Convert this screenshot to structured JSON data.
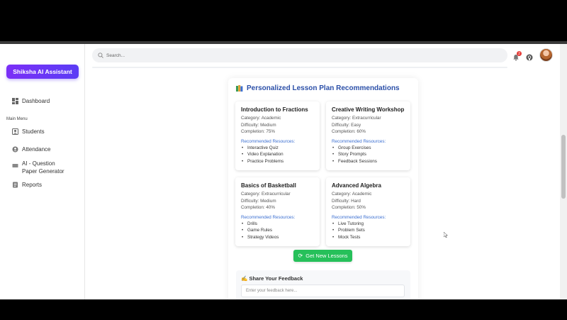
{
  "sidebar": {
    "brand": "Shiksha AI Assistant",
    "dashboard": "Dashboard",
    "menu_heading": "Main Menu",
    "items": [
      {
        "label": "Students",
        "icon": "student-icon"
      },
      {
        "label": "Attendance",
        "icon": "attendance-icon"
      },
      {
        "label": "AI - Question Paper Generator",
        "icon": "document-icon"
      },
      {
        "label": "Reports",
        "icon": "report-icon"
      }
    ]
  },
  "header": {
    "search_placeholder": "Search...",
    "notification_count": "2",
    "icons": [
      "search-icon",
      "bell-icon",
      "github-icon",
      "avatar"
    ]
  },
  "main": {
    "title": "Personalized Lesson Plan Recommendations",
    "cards": [
      {
        "title": "Introduction to Fractions",
        "category": "Category: Academic",
        "difficulty": "Difficulty: Medium",
        "completion": "Completion: 75%",
        "resources_label": "Recommended Resources:",
        "resources": [
          "Interactive Quiz",
          "Video Explanation",
          "Practice Problems"
        ]
      },
      {
        "title": "Creative Writing Workshop",
        "category": "Category: Extracurricular",
        "difficulty": "Difficulty: Easy",
        "completion": "Completion: 60%",
        "resources_label": "Recommended Resources:",
        "resources": [
          "Group Exercises",
          "Story Prompts",
          "Feedback Sessions"
        ]
      },
      {
        "title": "Basics of Basketball",
        "category": "Category: Extracurricular",
        "difficulty": "Difficulty: Medium",
        "completion": "Completion: 40%",
        "resources_label": "Recommended Resources:",
        "resources": [
          "Drills",
          "Game Rules",
          "Strategy Videos"
        ]
      },
      {
        "title": "Advanced Algebra",
        "category": "Category: Academic",
        "difficulty": "Difficulty: Hard",
        "completion": "Completion: 50%",
        "resources_label": "Recommended Resources:",
        "resources": [
          "Live Tutoring",
          "Problem Sets",
          "Mock Tests"
        ]
      }
    ],
    "button_label": "Get New Lessons",
    "feedback_title": "Share Your Feedback",
    "feedback_placeholder": "Enter your feedback here..."
  },
  "colors": {
    "brand_start": "#7b2ff7",
    "brand_end": "#5b3df5",
    "title_blue": "#2b4fa8",
    "resource_blue": "#3b6fd1",
    "button_green": "#26c05a",
    "badge_red": "#e53935"
  }
}
